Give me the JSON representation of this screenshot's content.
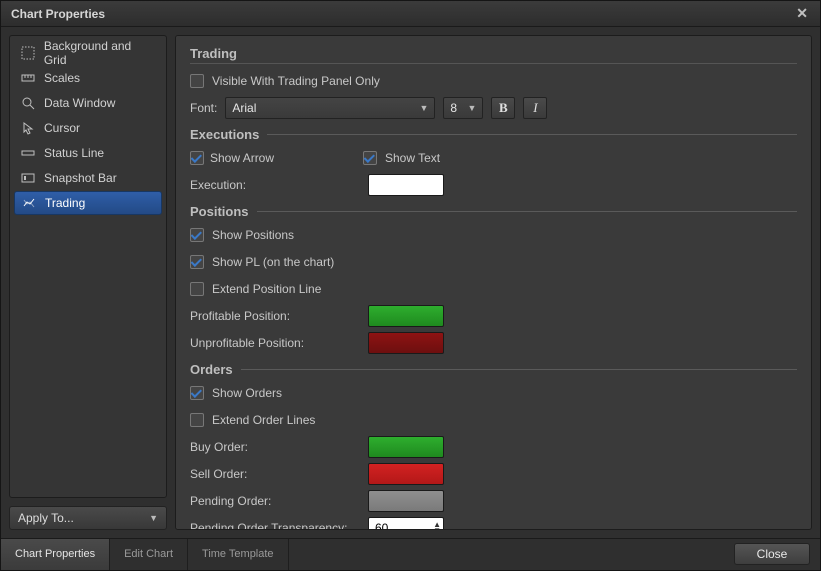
{
  "window": {
    "title": "Chart Properties"
  },
  "sidebar": {
    "items": [
      {
        "label": "Background and Grid"
      },
      {
        "label": "Scales"
      },
      {
        "label": "Data Window"
      },
      {
        "label": "Cursor"
      },
      {
        "label": "Status Line"
      },
      {
        "label": "Snapshot Bar"
      },
      {
        "label": "Trading"
      }
    ],
    "apply_to_label": "Apply To..."
  },
  "trading": {
    "heading": "Trading",
    "visible_panel_only_label": "Visible With Trading Panel Only",
    "visible_panel_only_checked": false,
    "font_label": "Font:",
    "font_family": "Arial",
    "font_size": "8",
    "bold_label": "B",
    "italic_label": "I",
    "executions": {
      "heading": "Executions",
      "show_arrow_label": "Show Arrow",
      "show_arrow_checked": true,
      "show_text_label": "Show Text",
      "show_text_checked": true,
      "execution_label": "Execution:",
      "execution_color": "#ffffff"
    },
    "positions": {
      "heading": "Positions",
      "show_positions_label": "Show Positions",
      "show_positions_checked": true,
      "show_pl_label": "Show PL (on the chart)",
      "show_pl_checked": true,
      "extend_line_label": "Extend Position Line",
      "extend_line_checked": false,
      "profitable_label": "Profitable Position:",
      "profitable_color": "#27a327",
      "unprofitable_label": "Unprofitable Position:",
      "unprofitable_color": "#7d1111"
    },
    "orders": {
      "heading": "Orders",
      "show_orders_label": "Show Orders",
      "show_orders_checked": true,
      "extend_lines_label": "Extend Order Lines",
      "extend_lines_checked": false,
      "buy_label": "Buy Order:",
      "buy_color": "#27a327",
      "sell_label": "Sell Order:",
      "sell_color": "#c71f1f",
      "pending_label": "Pending Order:",
      "pending_color": "#858585",
      "pending_transparency_label": "Pending Order Transparency:",
      "pending_transparency_value": "60"
    }
  },
  "footer": {
    "tabs": [
      {
        "label": "Chart Properties"
      },
      {
        "label": "Edit Chart"
      },
      {
        "label": "Time Template"
      }
    ],
    "close_label": "Close"
  }
}
